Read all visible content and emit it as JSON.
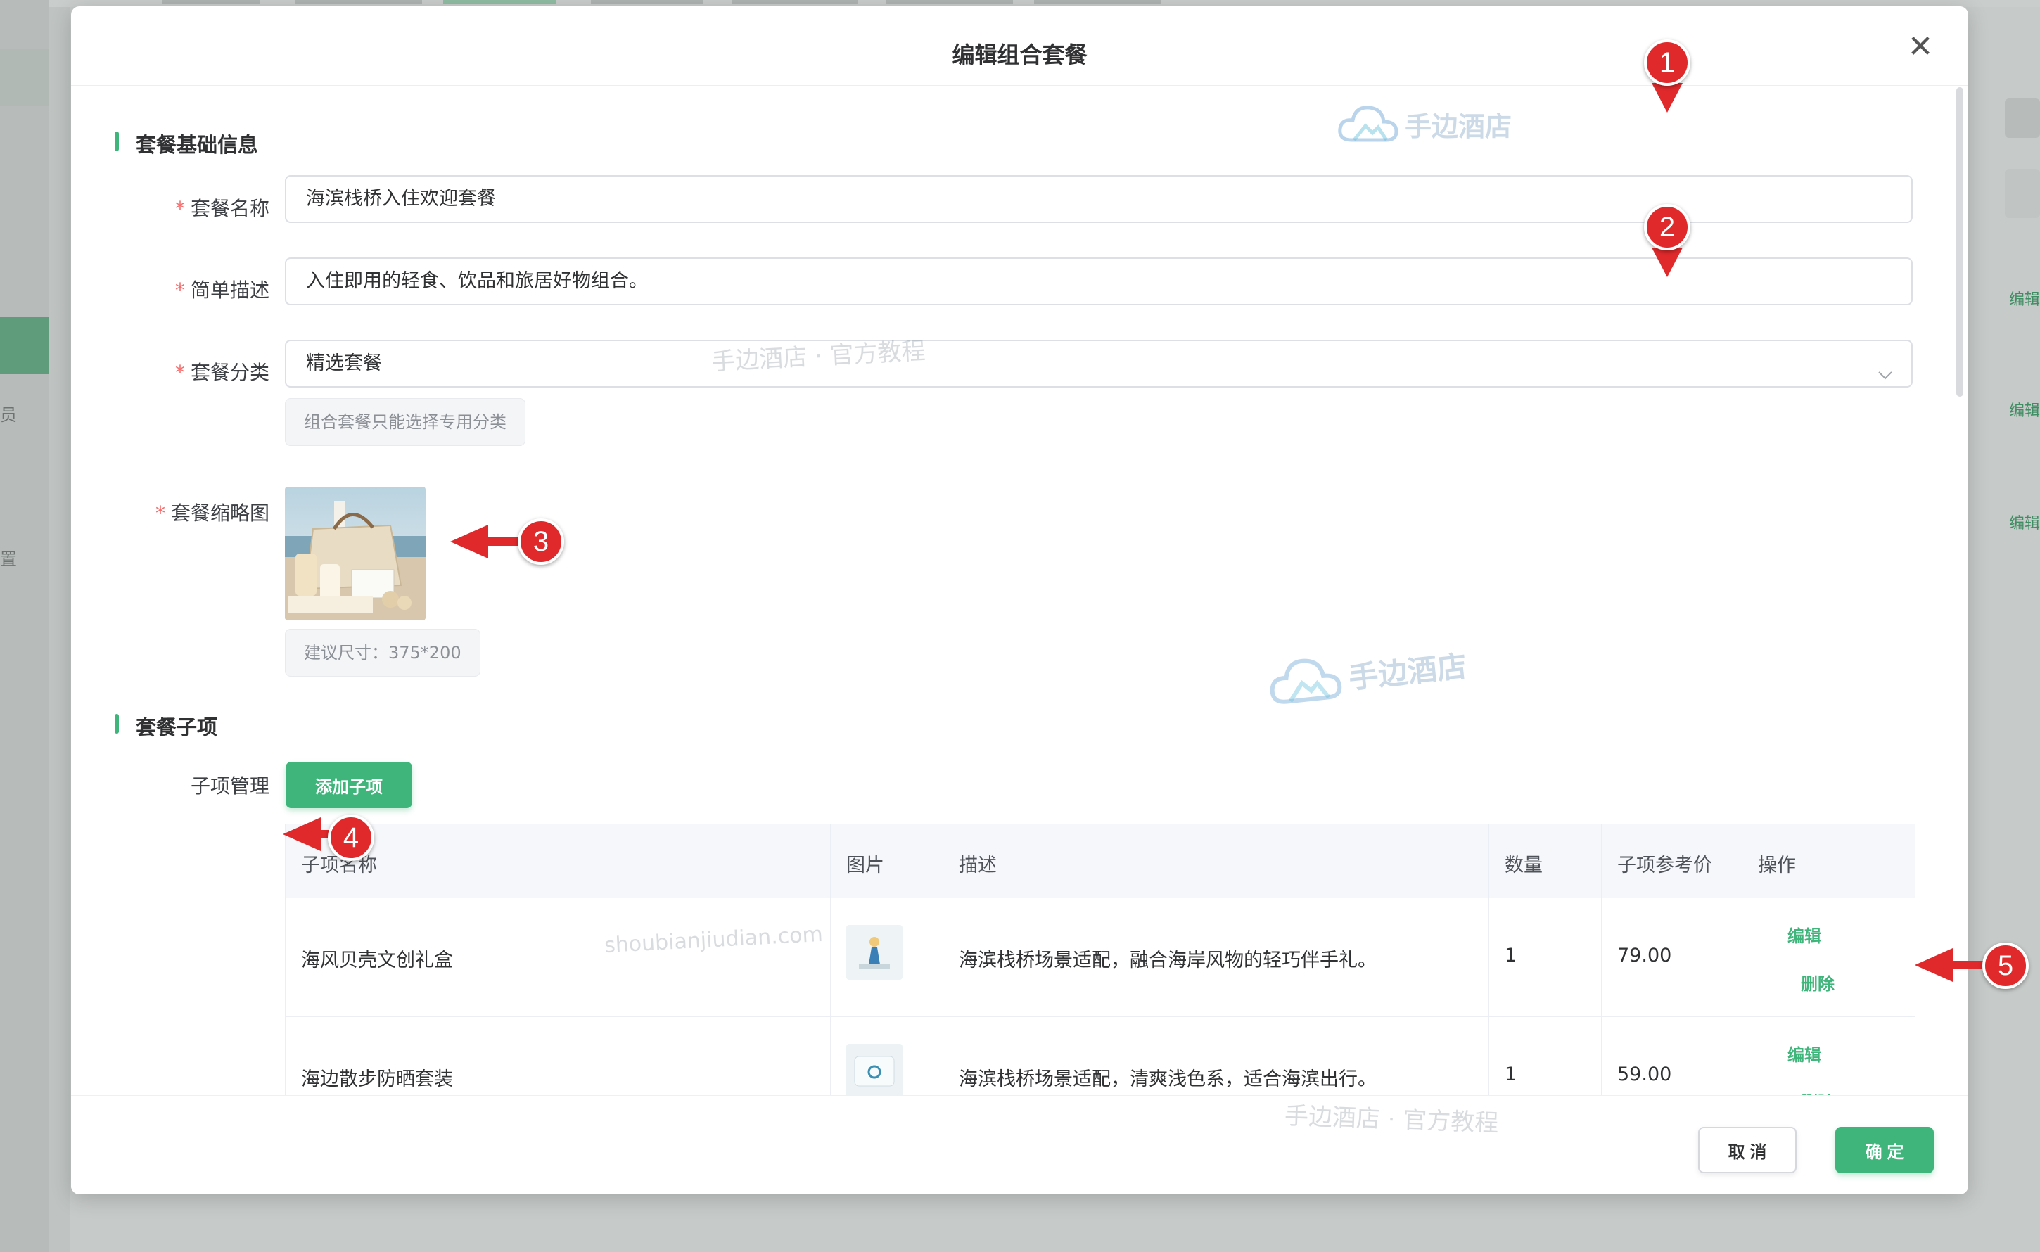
{
  "background": {
    "side_chars": [
      "员",
      "置"
    ],
    "edit_links": [
      "编辑",
      "编辑",
      "编辑"
    ]
  },
  "dialog": {
    "title": "编辑组合套餐",
    "close_glyph": "✕"
  },
  "basic_section": {
    "title": "套餐基础信息",
    "name_label": "套餐名称",
    "name_value": "海滨栈桥入住欢迎套餐",
    "desc_label": "简单描述",
    "desc_value": "入住即用的轻食、饮品和旅居好物组合。",
    "category_label": "套餐分类",
    "category_value": "精选套餐",
    "category_tip": "组合套餐只能选择专用分类",
    "thumb_label": "套餐缩略图",
    "thumb_tip": "建议尺寸：375*200",
    "required_mark": "*"
  },
  "items_section": {
    "title": "套餐子项",
    "manage_label": "子项管理",
    "add_button": "添加子项",
    "table": {
      "headers": [
        "子项名称",
        "图片",
        "描述",
        "数量",
        "子项参考价",
        "操作"
      ],
      "rows": [
        {
          "name": "海风贝壳文创礼盒",
          "desc": "海滨栈桥场景适配，融合海岸风物的轻巧伴手礼。",
          "qty": "1",
          "price": "79.00",
          "edit": "编辑",
          "delete": "删除"
        },
        {
          "name": "海边散步防晒套装",
          "desc": "海滨栈桥场景适配，清爽浅色系，适合海滨出行。",
          "qty": "1",
          "price": "59.00",
          "edit": "编辑",
          "delete": "删除"
        }
      ]
    }
  },
  "footer": {
    "cancel": "取 消",
    "confirm": "确 定"
  },
  "watermarks": {
    "brand": "手边酒店",
    "tutorial": "手边酒店 · 官方教程",
    "url": "shoubianjiudian.com"
  },
  "annotations": [
    "1",
    "2",
    "3",
    "4",
    "5"
  ],
  "colors": {
    "accent": "#3fb57b",
    "required": "#f56c6c",
    "annotation": "#e0292b"
  }
}
